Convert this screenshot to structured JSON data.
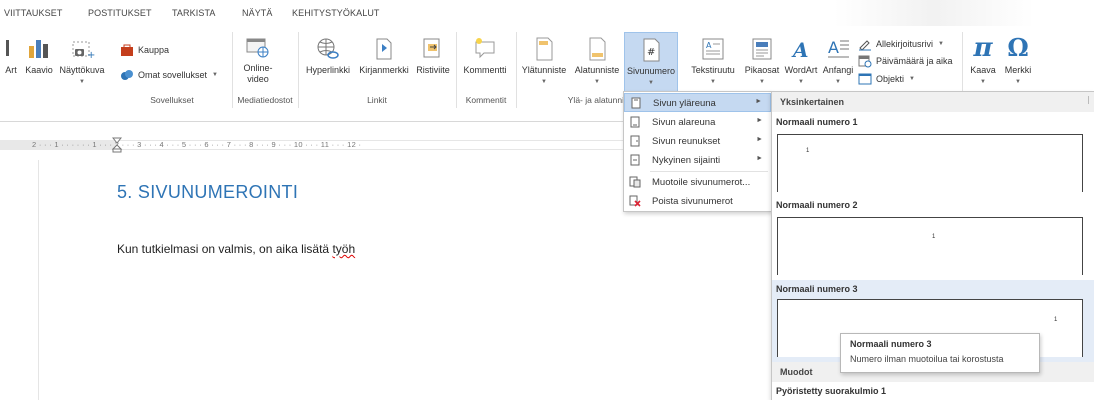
{
  "tabs": [
    "VIITTAUKSET",
    "POSTITUKSET",
    "TARKISTA",
    "NÄYTÄ",
    "KEHITYSTYÖKALUT"
  ],
  "ribbon": {
    "art": "Art",
    "kaavio": "Kaavio",
    "nayttokuva": "Näyttökuva",
    "kauppa": "Kauppa",
    "omat_sovellukset": "Omat sovellukset",
    "online_video_1": "Online-",
    "online_video_2": "video",
    "hyperlinkki": "Hyperlinkki",
    "kirjanmerkki": "Kirjanmerkki",
    "ristiviite": "Ristiviite",
    "kommentti": "Kommentti",
    "ylatunniste": "Ylätunniste",
    "alatunniste": "Alatunniste",
    "sivunumero": "Sivunumero",
    "tekstiruutu": "Tekstiruutu",
    "pikaosat": "Pikaosat",
    "wordart": "WordArt",
    "anfangi": "Anfangi",
    "allekirjoitusrivi": "Allekirjoitusrivi",
    "paivamaara": "Päivämäärä ja aika",
    "objekti": "Objekti",
    "kaava": "Kaava",
    "merkki": "Merkki",
    "groups": {
      "sovellukset": "Sovellukset",
      "mediatiedostot": "Mediatiedostot",
      "linkit": "Linkit",
      "kommentit": "Kommentit",
      "yla_alatunniste": "Ylä- ja alatunni"
    }
  },
  "ruler": "2 · · · 1 · · · · · · 1 · · · 2 · · · 3 · · · 4 · · · 5 · · · 6 · · · 7 · · · 8 · · · 9 · · · 10 · · · 11 · · · 12 ·",
  "document": {
    "heading": "5. SIVUNUMEROINTI",
    "paragraph_before": "Kun tutkielmasi on valmis, on aika lisätä ",
    "paragraph_error": "työh"
  },
  "menu": {
    "items": [
      {
        "label": "Sivun yläreuna",
        "submenu": true,
        "highlighted": true
      },
      {
        "label": "Sivun alareuna",
        "submenu": true
      },
      {
        "label": "Sivun reunukset",
        "submenu": true
      },
      {
        "label": "Nykyinen sijainti",
        "submenu": true
      },
      {
        "label": "Muotoile sivunumerot...",
        "submenu": false
      },
      {
        "label": "Poista sivunumerot",
        "submenu": false
      }
    ]
  },
  "gallery": {
    "section_simple": "Yksinkertainen",
    "item1": "Normaali numero 1",
    "item2": "Normaali numero 2",
    "item3": "Normaali numero 3",
    "sample_number": "1",
    "section_shapes": "Muodot",
    "item4": "Pyöristetty suorakulmio 1"
  },
  "tooltip": {
    "title": "Normaali numero 3",
    "description": "Numero ilman muotoilua tai korostusta"
  },
  "colors": {
    "heading": "#2e74b5",
    "menu_highlight": "#c5d9f1",
    "selected_button": "#c5d9f1",
    "gallery_selection": "#e4ecf7",
    "spell_error": "#dd0000"
  }
}
